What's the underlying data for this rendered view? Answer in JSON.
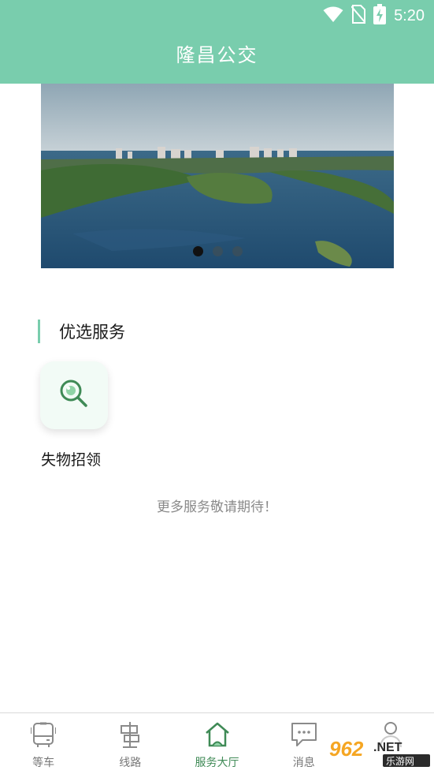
{
  "status_bar": {
    "time": "5:20",
    "icons": [
      "wifi-icon",
      "no-sim-icon",
      "battery-charging-icon"
    ]
  },
  "header": {
    "title": "隆昌公交"
  },
  "banner": {
    "slide_count": 3,
    "active_index": 0
  },
  "section": {
    "title": "优选服务"
  },
  "services": [
    {
      "label": "失物招领",
      "icon": "search-icon"
    }
  ],
  "more_hint": "更多服务敬请期待！",
  "bottom_nav": {
    "items": [
      {
        "label": "等车",
        "icon": "bus-icon"
      },
      {
        "label": "线路",
        "icon": "route-sign-icon"
      },
      {
        "label": "服务大厅",
        "icon": "home-icon"
      },
      {
        "label": "消息",
        "icon": "message-icon"
      },
      {
        "label": "",
        "icon": "user-icon"
      }
    ],
    "active_index": 2
  },
  "watermark": {
    "text": "962.NET",
    "sub": "乐游网"
  },
  "colors": {
    "primary": "#79cdad",
    "active_nav": "#3f8a56",
    "hint_text": "#8a8a8a"
  }
}
